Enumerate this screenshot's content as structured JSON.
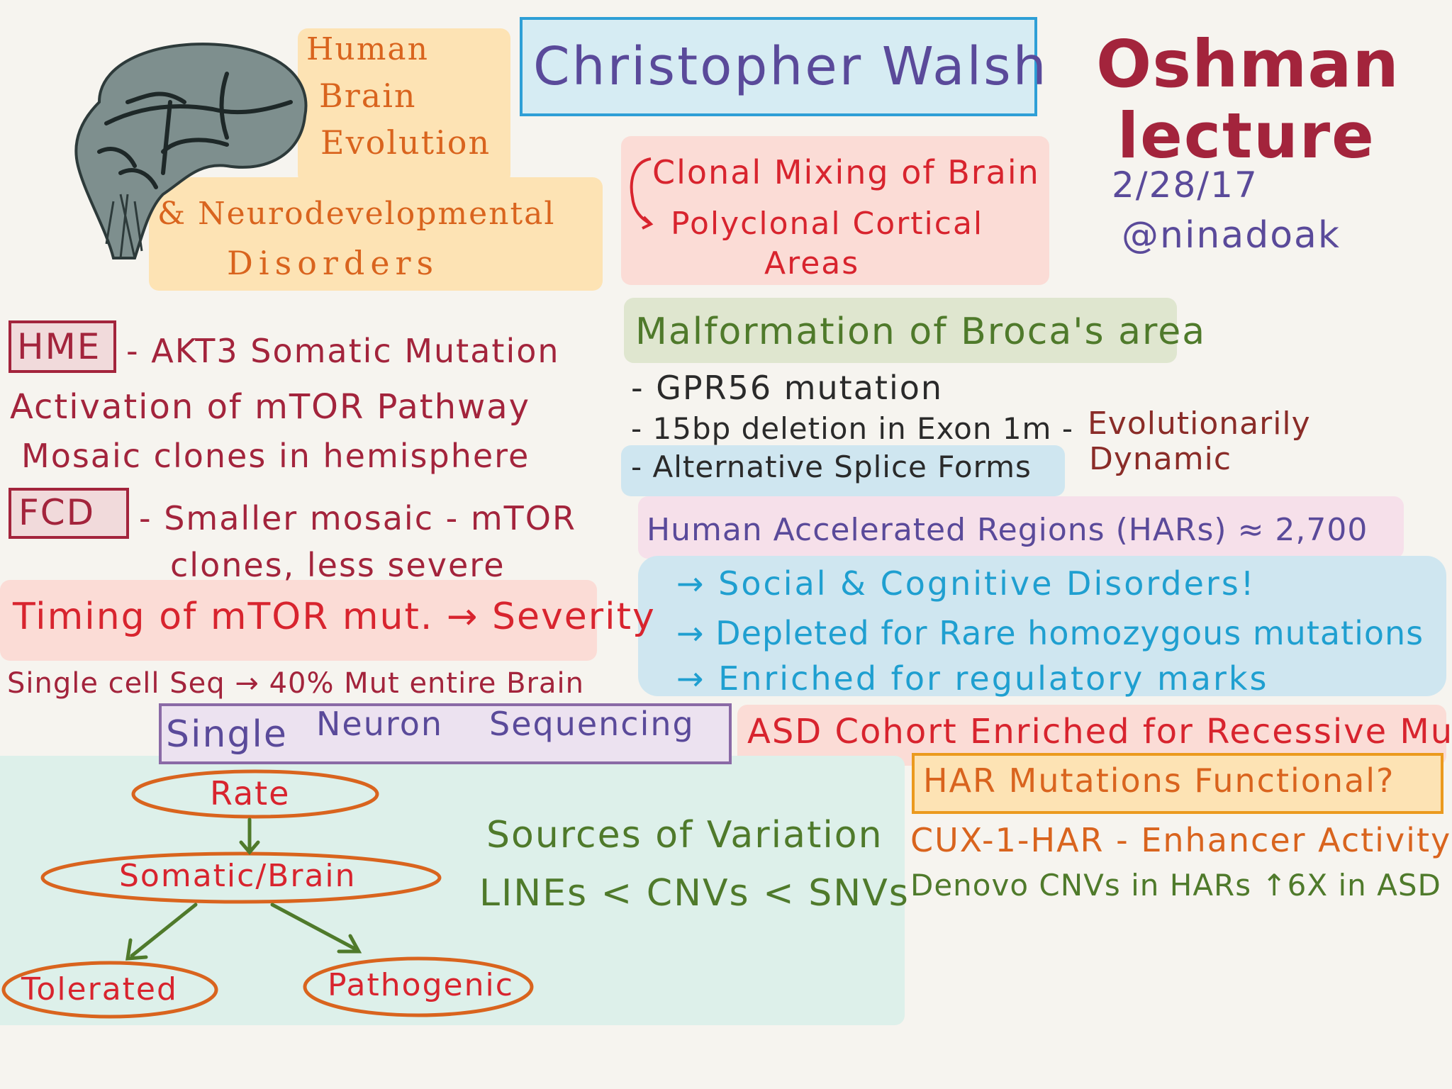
{
  "header": {
    "speaker_name": "Christopher Walsh",
    "lecture_line1": "Oshman",
    "lecture_line2": "lecture",
    "date": "2/28/17",
    "handle": "@ninadoak"
  },
  "topic": {
    "line1": "Human",
    "line2": "Brain",
    "line3": "Evolution",
    "line4": "& Neurodevelopmental",
    "line5": "Disorders"
  },
  "clonal": {
    "line1": "Clonal Mixing of Brain",
    "line2": "Polyclonal Cortical",
    "line3": "Areas"
  },
  "hme_section": {
    "hme_label": "HME",
    "hme_text": "- AKT3 Somatic Mutation",
    "line2": "Activation of mTOR Pathway",
    "line3": "Mosaic clones in hemisphere",
    "fcd_label": "FCD",
    "fcd_text": "- Smaller mosaic - mTOR",
    "fcd_line2": "clones, less severe",
    "timing": "Timing of mTOR mut. → Severity",
    "single_cell": "Single cell Seq → 40% Mut entire Brain"
  },
  "broca": {
    "title": "Malformation of Broca's area",
    "item1": "- GPR56 mutation",
    "item2": "- 15bp deletion in Exon 1m -",
    "item3": "- Alternative Splice Forms",
    "side_note_line1": "Evolutionarily",
    "side_note_line2": "Dynamic"
  },
  "hars": {
    "title": "Human Accelerated Regions (HARs) ≈ 2,700",
    "item1": "→ Social & Cognitive Disorders!",
    "item2": "→ Depleted for Rare homozygous mutations",
    "item3": "→ Enriched for regulatory marks",
    "asd": "ASD Cohort Enriched for Recessive Mut",
    "har_functional": "HAR Mutations Functional?",
    "cux": "CUX-1-HAR - Enhancer Activity",
    "denovo": "Denovo CNVs in HARs ↑6X in ASD"
  },
  "sequencing": {
    "title_part1": "Single",
    "title_part2": "Neuron",
    "title_part3": "Sequencing",
    "node_rate": "Rate",
    "node_somatic": "Somatic/Brain",
    "node_tolerated": "Tolerated",
    "node_pathogenic": "Pathogenic",
    "sources_line1": "Sources of Variation",
    "sources_line2": "LINEs < CNVs < SNVs"
  },
  "icons": {
    "brain": "brain-icon"
  },
  "colors": {
    "orange_highlight": "#fde3b4",
    "pink_highlight": "#fbdcd6",
    "green_highlight": "#dfe6cf",
    "blue_highlight": "#cfe6f0",
    "mint_highlight": "#ddf0ea",
    "maroon_text": "#a3243c",
    "purple_text": "#5a4a9a",
    "orange_text": "#d9641e",
    "red_text": "#d8242e",
    "green_text": "#4f7a2b",
    "cyan_text": "#1f9fd0"
  }
}
